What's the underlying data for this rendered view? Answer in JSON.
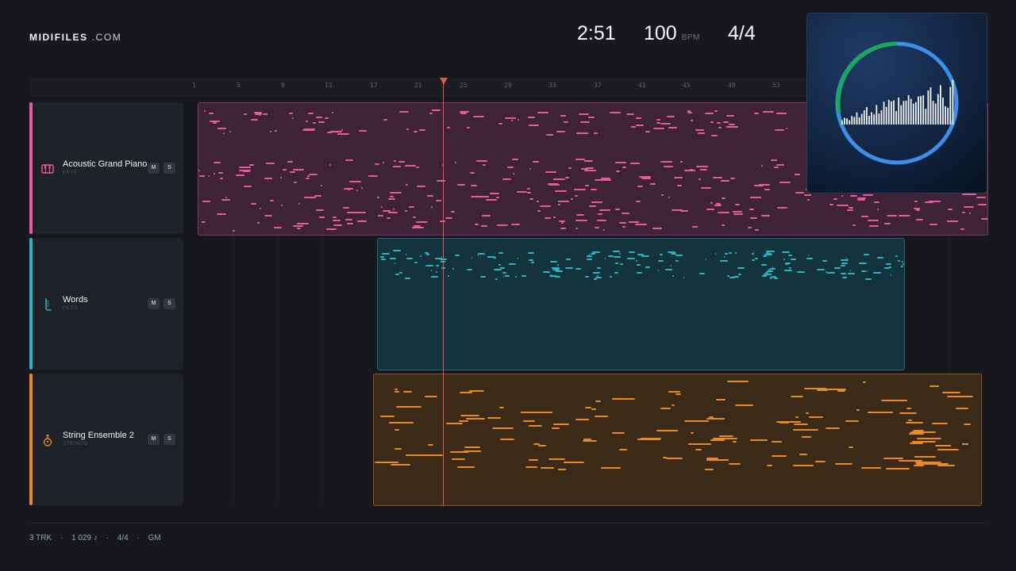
{
  "brand": {
    "bold": "MIDIFILES",
    "light": ".COM"
  },
  "transport": {
    "time": "2:51",
    "bpm": "100",
    "bpm_unit": "BPM",
    "signature": "4/4"
  },
  "ruler": {
    "ticks": [
      "1",
      "5",
      "9",
      "13",
      "17",
      "21",
      "25",
      "29",
      "33",
      "37",
      "41",
      "45",
      "49",
      "53"
    ]
  },
  "tracks": [
    {
      "name": "Acoustic Grand Piano",
      "category": "KEYS",
      "icon": "piano-keys-icon",
      "color": "#e85aa0",
      "clip_bg": "#3e2235",
      "clip_border": "#7a3a5e",
      "mute": "M",
      "solo": "S"
    },
    {
      "name": "Words",
      "category": "REED",
      "icon": "reed-instrument-icon",
      "color": "#2bb3c7",
      "clip_bg": "#14343d",
      "clip_border": "#1f6a77",
      "mute": "M",
      "solo": "S"
    },
    {
      "name": "String Ensemble 2",
      "category": "STRINGS",
      "icon": "violin-icon",
      "color": "#e88a25",
      "clip_bg": "#3c2a18",
      "clip_border": "#8a5a22",
      "mute": "M",
      "solo": "S"
    }
  ],
  "footer": {
    "tracks": "3 TRK",
    "notes": "1 029 ♪",
    "signature": "4/4",
    "standard": "GM",
    "sep": "·"
  },
  "album_art": {
    "ring_green": "#1aa85a",
    "ring_blue": "#3d8ee8"
  }
}
